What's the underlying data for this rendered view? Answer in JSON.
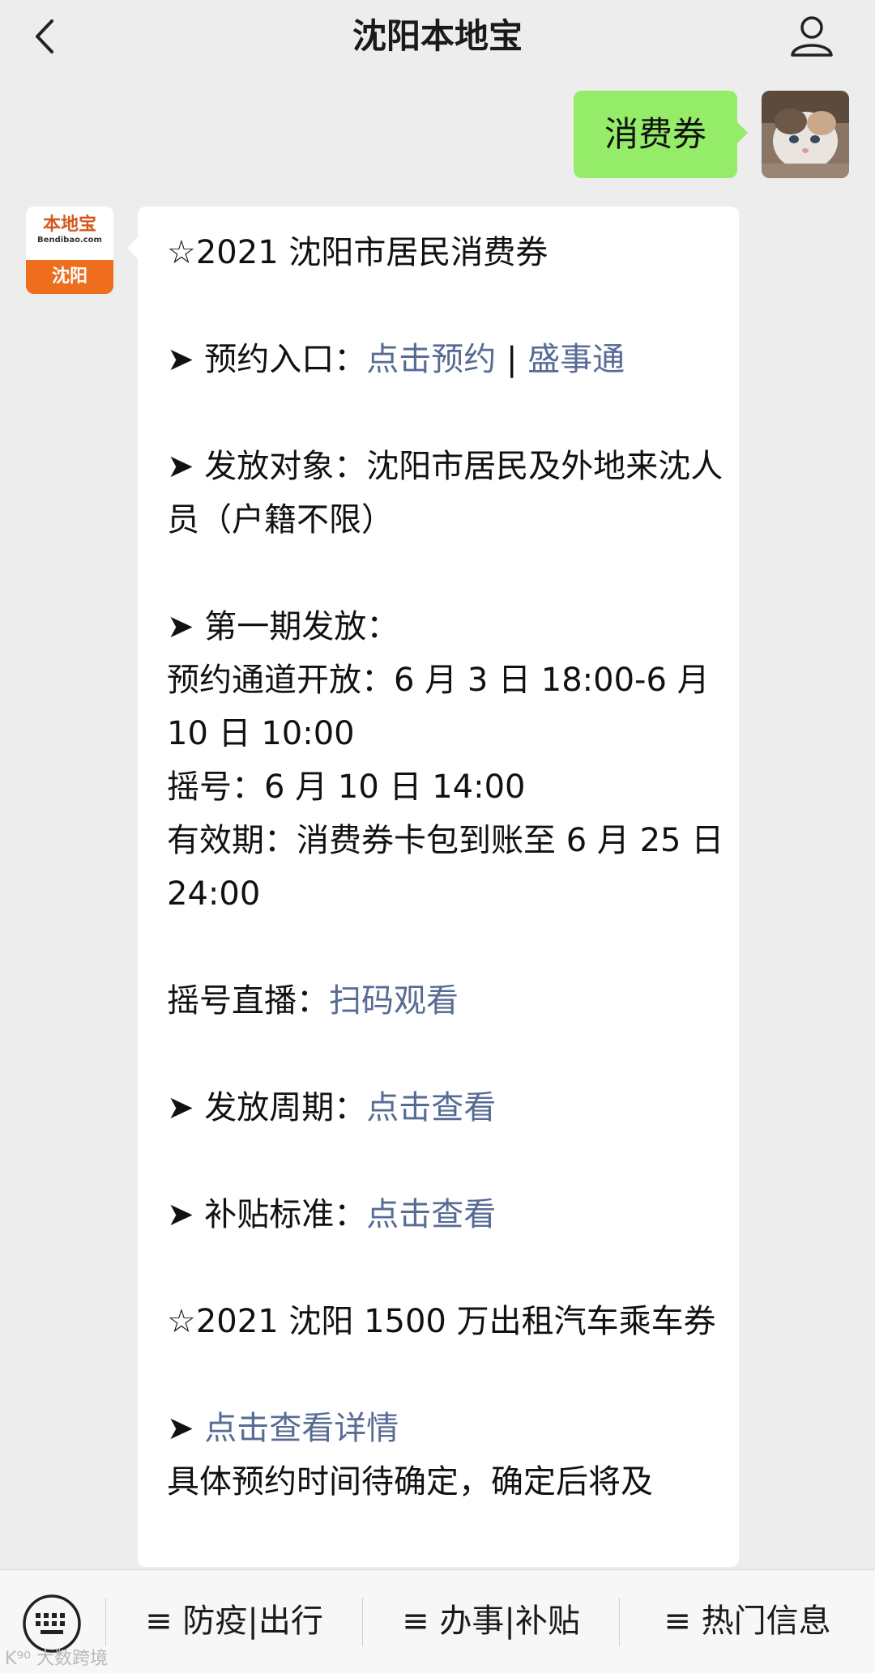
{
  "header": {
    "title": "沈阳本地宝",
    "back_icon": "chevron-left-icon",
    "profile_icon": "person-icon"
  },
  "messages": {
    "outgoing": {
      "text": "消费券"
    },
    "incoming": {
      "avatar": {
        "logo_main": "本地宝",
        "logo_sub": "Bendibao.com",
        "logo_city": "沈阳"
      },
      "lines": {
        "l1": "☆2021 沈阳市居民消费券",
        "l2_prefix": "➤ 预约入口：",
        "l2_link1": "点击预约",
        "l2_sep": " | ",
        "l2_link2": "盛事通",
        "l3": "➤ 发放对象：沈阳市居民及外地来沈人员（户籍不限）",
        "l4": "➤ 第一期发放：",
        "l5": "预约通道开放：6 月 3 日 18:00-6 月 10 日 10:00",
        "l6": "摇号：6 月 10 日 14:00",
        "l7": "有效期：消费券卡包到账至 6 月 25 日 24:00",
        "l8_prefix": "摇号直播：",
        "l8_link": "扫码观看",
        "l9_prefix": "➤ 发放周期：",
        "l9_link": "点击查看",
        "l10_prefix": "➤ 补贴标准：",
        "l10_link": "点击查看",
        "l11": "☆2021 沈阳 1500 万出租汽车乘车券",
        "l12_prefix": "➤ ",
        "l12_link": "点击查看详情",
        "l13": "具体预约时间待确定，确定后将及"
      }
    }
  },
  "menu": {
    "keyboard_icon": "keyboard-icon",
    "item1": "≡ 防疫|出行",
    "item2": "≡ 办事|补贴",
    "item3": "≡ 热门信息"
  },
  "watermark": "K⁹⁰ 大数跨境",
  "colors": {
    "bubble_out": "#95ec69",
    "link": "#576b95",
    "background": "#ededed"
  }
}
